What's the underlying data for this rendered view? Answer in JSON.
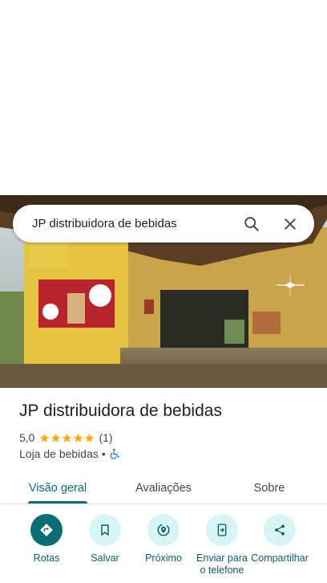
{
  "search": {
    "query": "JP distribuidora de bebidas"
  },
  "place": {
    "name": "JP distribuidora de bebidas",
    "rating": "5,0",
    "stars_filled": 5,
    "reviews_count": "(1)",
    "category": "Loja de bebidas",
    "separator": "•"
  },
  "tabs": [
    {
      "label": "Visão geral",
      "active": true
    },
    {
      "label": "Avaliações",
      "active": false
    },
    {
      "label": "Sobre",
      "active": false
    }
  ],
  "actions": [
    {
      "label": "Rotas",
      "icon": "directions-icon"
    },
    {
      "label": "Salvar",
      "icon": "bookmark-icon"
    },
    {
      "label": "Próximo",
      "icon": "nearby-icon"
    },
    {
      "label": "Enviar para o telefone",
      "icon": "send-to-phone-icon"
    },
    {
      "label": "Compartilhar",
      "icon": "share-icon"
    }
  ],
  "colors": {
    "accent": "#0b6e73",
    "chip_bg": "#d8f5f5",
    "star": "#f9ab00"
  }
}
